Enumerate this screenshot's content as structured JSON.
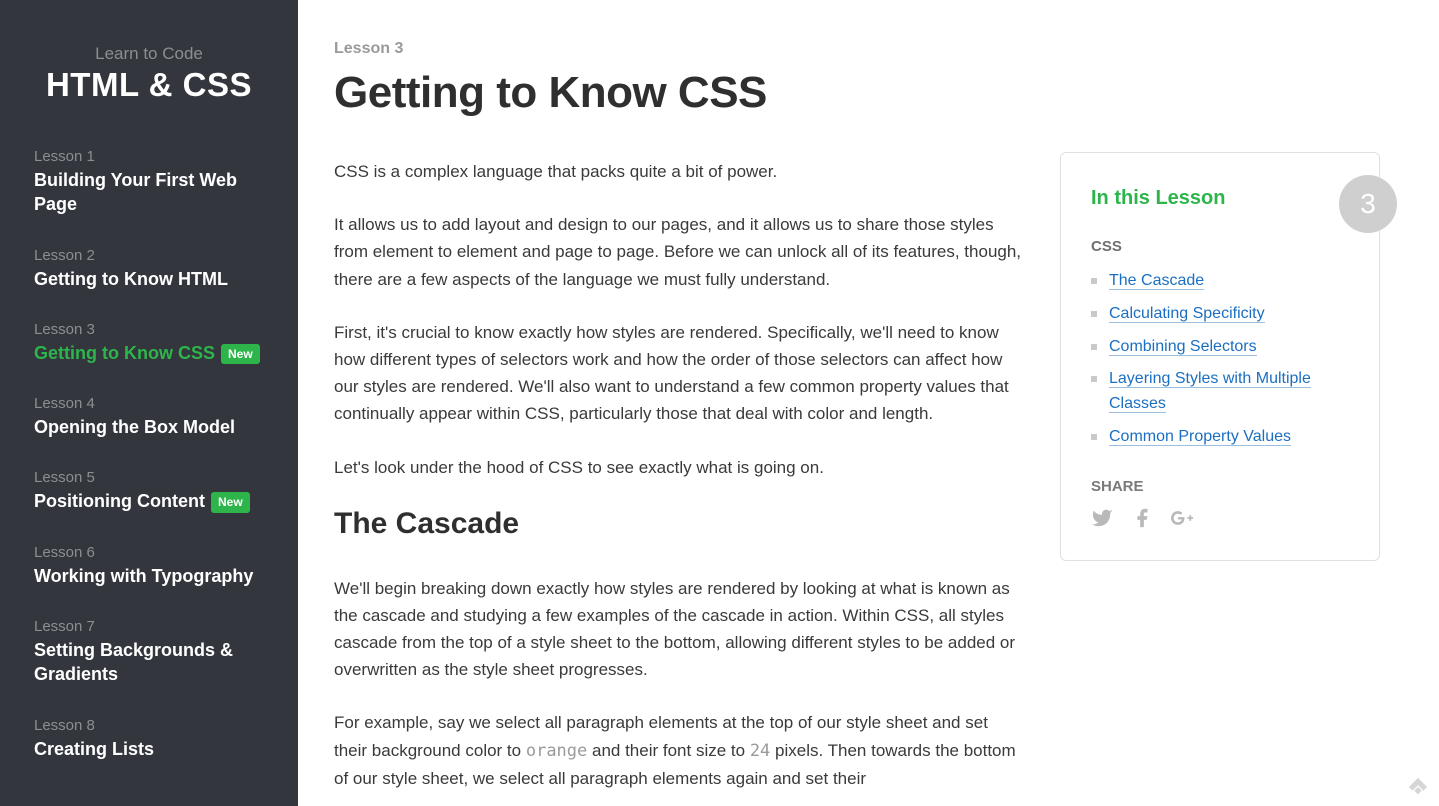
{
  "sidebar": {
    "subtitle": "Learn to Code",
    "title": "HTML & CSS",
    "lessons": [
      {
        "num": "Lesson 1",
        "title": "Building Your First Web Page",
        "active": false,
        "new": false
      },
      {
        "num": "Lesson 2",
        "title": "Getting to Know HTML",
        "active": false,
        "new": false
      },
      {
        "num": "Lesson 3",
        "title": "Getting to Know CSS",
        "active": true,
        "new": true
      },
      {
        "num": "Lesson 4",
        "title": "Opening the Box Model",
        "active": false,
        "new": false
      },
      {
        "num": "Lesson 5",
        "title": "Positioning Content",
        "active": false,
        "new": true
      },
      {
        "num": "Lesson 6",
        "title": "Working with Typography",
        "active": false,
        "new": false
      },
      {
        "num": "Lesson 7",
        "title": "Setting Backgrounds & Gradients",
        "active": false,
        "new": false
      },
      {
        "num": "Lesson 8",
        "title": "Creating Lists",
        "active": false,
        "new": false
      }
    ],
    "new_badge": "New"
  },
  "article": {
    "lesson_label": "Lesson 3",
    "title": "Getting to Know CSS",
    "p1": "CSS is a complex language that packs quite a bit of power.",
    "p2": "It allows us to add layout and design to our pages, and it allows us to share those styles from element to element and page to page. Before we can unlock all of its features, though, there are a few aspects of the language we must fully understand.",
    "p3": "First, it's crucial to know exactly how styles are rendered. Specifically, we'll need to know how different types of selectors work and how the order of those selectors can affect how our styles are rendered. We'll also want to understand a few common property values that continually appear within CSS, particularly those that deal with color and length.",
    "p4": "Let's look under the hood of CSS to see exactly what is going on.",
    "section1_heading": "The Cascade",
    "p5": "We'll begin breaking down exactly how styles are rendered by looking at what is known as the cascade and studying a few examples of the cascade in action. Within CSS, all styles cascade from the top of a style sheet to the bottom, allowing different styles to be added or overwritten as the style sheet progresses.",
    "p6_pre": "For example, say we select all paragraph elements at the top of our style sheet and set their background color to ",
    "p6_code1": "orange",
    "p6_mid": " and their font size to ",
    "p6_code2": "24",
    "p6_post": " pixels. Then towards the bottom of our style sheet, we select all paragraph elements again and set their"
  },
  "toc": {
    "heading": "In this Lesson",
    "circle": "3",
    "subheading": "CSS",
    "items": [
      "The Cascade",
      "Calculating Specificity",
      "Combining Selectors",
      "Layering Styles with Multiple Classes",
      "Common Property Values"
    ],
    "share_heading": "SHARE"
  }
}
